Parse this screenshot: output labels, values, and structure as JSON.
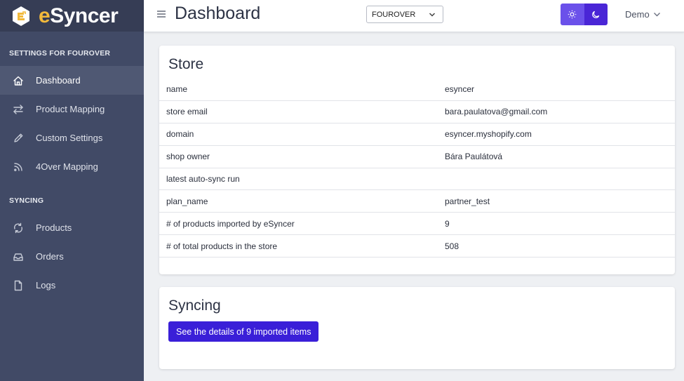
{
  "brand": {
    "name": "eSyncer",
    "first_letter": "e",
    "rest": "Syncer",
    "logo_icon": "esyncer-logo",
    "accent": "#f2b93b"
  },
  "sidebar": {
    "section1_title": "SETTINGS FOR FOUROVER",
    "section2_title": "SYNCING",
    "items": [
      {
        "label": "Dashboard",
        "icon": "home-icon",
        "active": true
      },
      {
        "label": "Product Mapping",
        "icon": "arrows-exchange-icon"
      },
      {
        "label": "Custom Settings",
        "icon": "pencil-icon"
      },
      {
        "label": "4Over Mapping",
        "icon": "rss-icon"
      },
      {
        "label": "Products",
        "icon": "sync-icon"
      },
      {
        "label": "Orders",
        "icon": "inbox-icon"
      },
      {
        "label": "Logs",
        "icon": "document-icon"
      }
    ]
  },
  "header": {
    "title": "Dashboard",
    "store_select": "FOUROVER",
    "theme_light_icon": "sun-icon",
    "theme_dark_icon": "moon-icon",
    "user": "Demo"
  },
  "store_card": {
    "title": "Store",
    "rows": [
      {
        "key": "name",
        "value": "esyncer"
      },
      {
        "key": "store email",
        "value": "bara.paulatova@gmail.com"
      },
      {
        "key": "domain",
        "value": "esyncer.myshopify.com"
      },
      {
        "key": "shop owner",
        "value": "Bára Paulátová"
      },
      {
        "key": "latest auto-sync run",
        "value": ""
      },
      {
        "key": "plan_name",
        "value": "partner_test"
      },
      {
        "key": "# of products imported by eSyncer",
        "value": "9"
      },
      {
        "key": "# of total products in the store",
        "value": "508"
      }
    ]
  },
  "sync_card": {
    "title": "Syncing",
    "button_label": "See the details of 9 imported items"
  },
  "colors": {
    "sidebar_bg": "#414a66",
    "primary_button": "#3a1fd8",
    "theme_light": "#6b51ea",
    "theme_dark": "#4a26d6"
  }
}
